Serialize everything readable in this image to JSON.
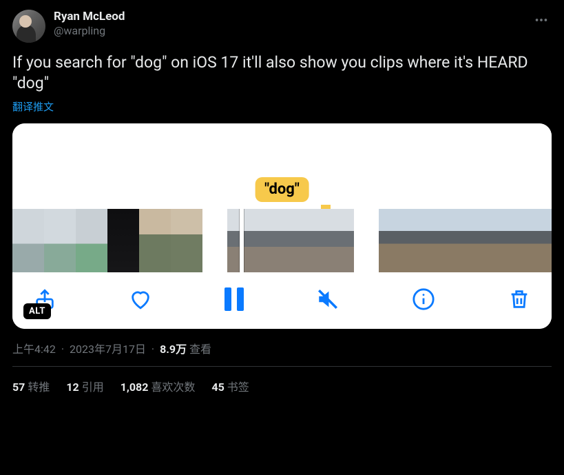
{
  "author": {
    "display_name": "Ryan McLeod",
    "handle": "@warpling"
  },
  "tweet_text": "If you search for \"dog\" on iOS 17 it'll also show you clips where it's HEARD \"dog\"",
  "translate_label": "翻译推文",
  "media": {
    "chip_label": "\"dog\"",
    "alt_badge": "ALT"
  },
  "timestamp": {
    "time": "上午4:42",
    "date": "2023年7月17日"
  },
  "views": {
    "count": "8.9万",
    "label": "查看"
  },
  "stats": {
    "retweets": {
      "count": "57",
      "label": "转推"
    },
    "quotes": {
      "count": "12",
      "label": "引用"
    },
    "likes": {
      "count": "1,082",
      "label": "喜欢次数"
    },
    "bookmarks": {
      "count": "45",
      "label": "书签"
    }
  }
}
